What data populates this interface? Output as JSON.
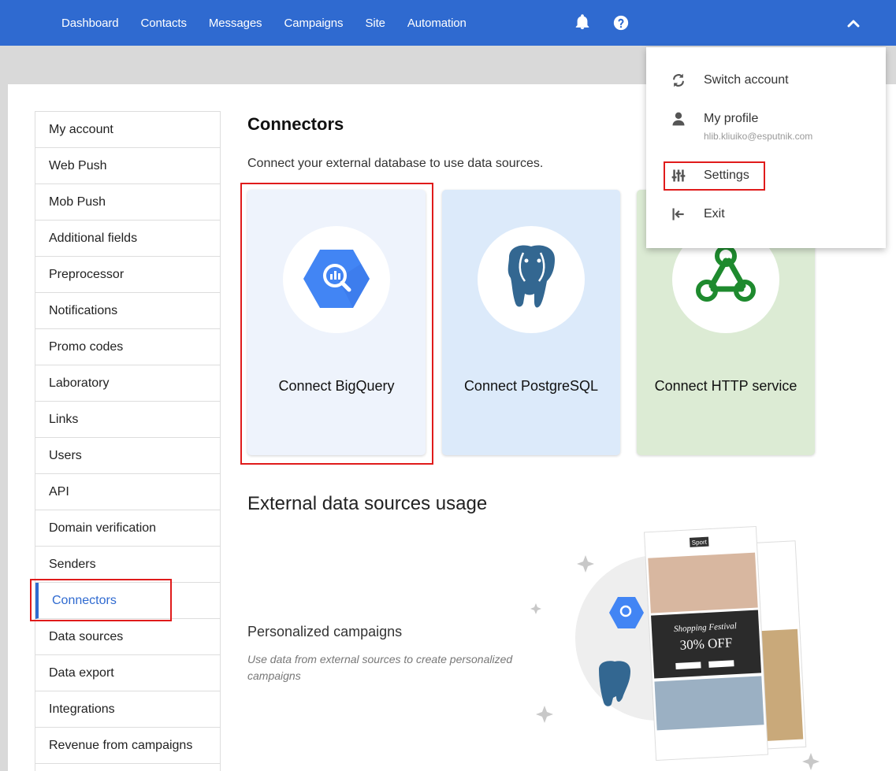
{
  "nav": {
    "items": [
      "Dashboard",
      "Contacts",
      "Messages",
      "Campaigns",
      "Site",
      "Automation"
    ]
  },
  "icons": {
    "bell": "bell-icon",
    "help": "help-icon",
    "chevron": "chevron-up-icon"
  },
  "sidebar": {
    "items": [
      {
        "label": "My account"
      },
      {
        "label": "Web Push"
      },
      {
        "label": "Mob Push"
      },
      {
        "label": "Additional fields"
      },
      {
        "label": "Preprocessor"
      },
      {
        "label": "Notifications"
      },
      {
        "label": "Promo codes"
      },
      {
        "label": "Laboratory"
      },
      {
        "label": "Links"
      },
      {
        "label": "Users"
      },
      {
        "label": "API"
      },
      {
        "label": "Domain verification"
      },
      {
        "label": "Senders"
      },
      {
        "label": "Connectors"
      },
      {
        "label": "Data sources"
      },
      {
        "label": "Data export"
      },
      {
        "label": "Integrations"
      },
      {
        "label": "Revenue from campaigns"
      }
    ],
    "active": "Connectors"
  },
  "main": {
    "title": "Connectors",
    "subtitle": "Connect your external database to use data sources.",
    "cards": [
      {
        "label": "Connect BigQuery",
        "icon": "bigquery-icon"
      },
      {
        "label": "Connect PostgreSQL",
        "icon": "postgresql-icon"
      },
      {
        "label": "Connect HTTP service",
        "icon": "webhook-icon"
      }
    ],
    "section_title": "External data sources usage",
    "personalized": {
      "title": "Personalized campaigns",
      "description": "Use data from external sources to create personalized campaigns"
    },
    "illustration": {
      "brand": "Sport",
      "banner": "Shopping Festival",
      "offer": "30% OFF"
    }
  },
  "dropdown": {
    "switch_account": "Switch account",
    "my_profile": "My profile",
    "email": "hlib.kliuiko@esputnik.com",
    "settings": "Settings",
    "exit": "Exit"
  },
  "colors": {
    "topbar": "#2f6ad0",
    "highlight": "#e01b1b",
    "active": "#2f6ad0"
  }
}
